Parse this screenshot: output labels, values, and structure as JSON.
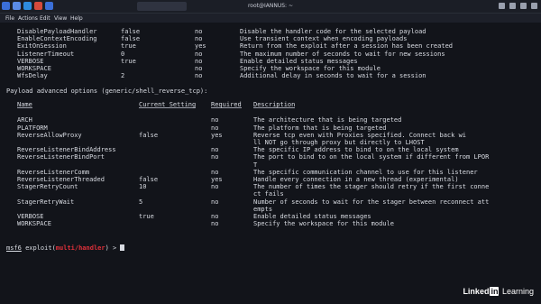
{
  "taskbar": {
    "title": "root@IANNUS: ~",
    "icon_colors": [
      "#3b6fd8",
      "#5a8be6",
      "#2e8cde",
      "#d64a3b",
      "#3b6fd8"
    ]
  },
  "menubar": {
    "items": [
      "File",
      "Actions",
      "Edit",
      "View",
      "Help"
    ]
  },
  "top_rows": [
    {
      "name": "DisablePayloadHandler",
      "current": "false",
      "required": "no",
      "description": "Disable the handler code for the selected payload"
    },
    {
      "name": "EnableContextEncoding",
      "current": "false",
      "required": "no",
      "description": "Use transient context when encoding payloads"
    },
    {
      "name": "ExitOnSession",
      "current": "true",
      "required": "yes",
      "description": "Return from the exploit after a session has been created"
    },
    {
      "name": "ListenerTimeout",
      "current": "0",
      "required": "no",
      "description": "The maximum number of seconds to wait for new sessions"
    },
    {
      "name": "VERBOSE",
      "current": "true",
      "required": "no",
      "description": "Enable detailed status messages"
    },
    {
      "name": "WORKSPACE",
      "current": "",
      "required": "no",
      "description": "Specify the workspace for this module"
    },
    {
      "name": "WfsDelay",
      "current": "2",
      "required": "no",
      "description": "Additional delay in seconds to wait for a session"
    }
  ],
  "payload_heading": "Payload advanced options (generic/shell_reverse_tcp):",
  "headers": {
    "name": "Name",
    "current": "Current Setting",
    "required": "Required",
    "description": "Description"
  },
  "payload_rows": [
    {
      "name": "ARCH",
      "current": "",
      "required": "no",
      "description": "The architecture that is being targeted"
    },
    {
      "name": "PLATFORM",
      "current": "",
      "required": "no",
      "description": "The platform that is being targeted"
    },
    {
      "name": "ReverseAllowProxy",
      "current": "false",
      "required": "yes",
      "description": "Reverse tcp even with Proxies specified. Connect back wi",
      "cont": "ll NOT go through proxy but directly to LHOST"
    },
    {
      "name": "ReverseListenerBindAddress",
      "current": "",
      "required": "no",
      "description": "The specific IP address to bind to on the local system"
    },
    {
      "name": "ReverseListenerBindPort",
      "current": "",
      "required": "no",
      "description": "The port to bind to on the local system if different from LPOR",
      "cont": "T"
    },
    {
      "name": "ReverseListenerComm",
      "current": "",
      "required": "no",
      "description": "The specific communication channel to use for this listener"
    },
    {
      "name": "ReverseListenerThreaded",
      "current": "false",
      "required": "yes",
      "description": "Handle every connection in a new thread (experimental)"
    },
    {
      "name": "StagerRetryCount",
      "current": "10",
      "required": "no",
      "description": "The number of times the stager should retry if the first conne",
      "cont": "ct fails"
    },
    {
      "name": "StagerRetryWait",
      "current": "5",
      "required": "no",
      "description": "Number of seconds to wait for the stager between reconnect att",
      "cont": "empts"
    },
    {
      "name": "VERBOSE",
      "current": "true",
      "required": "no",
      "description": "Enable detailed status messages"
    },
    {
      "name": "WORKSPACE",
      "current": "",
      "required": "no",
      "description": "Specify the workspace for this module"
    }
  ],
  "prompt": {
    "msf": "msf6",
    "exploit_open": " exploit(",
    "module": "multi/handler",
    "close": ") > "
  },
  "watermark": {
    "brand1": "Linked",
    "brand_in": "in",
    "brand2": "Learning"
  }
}
